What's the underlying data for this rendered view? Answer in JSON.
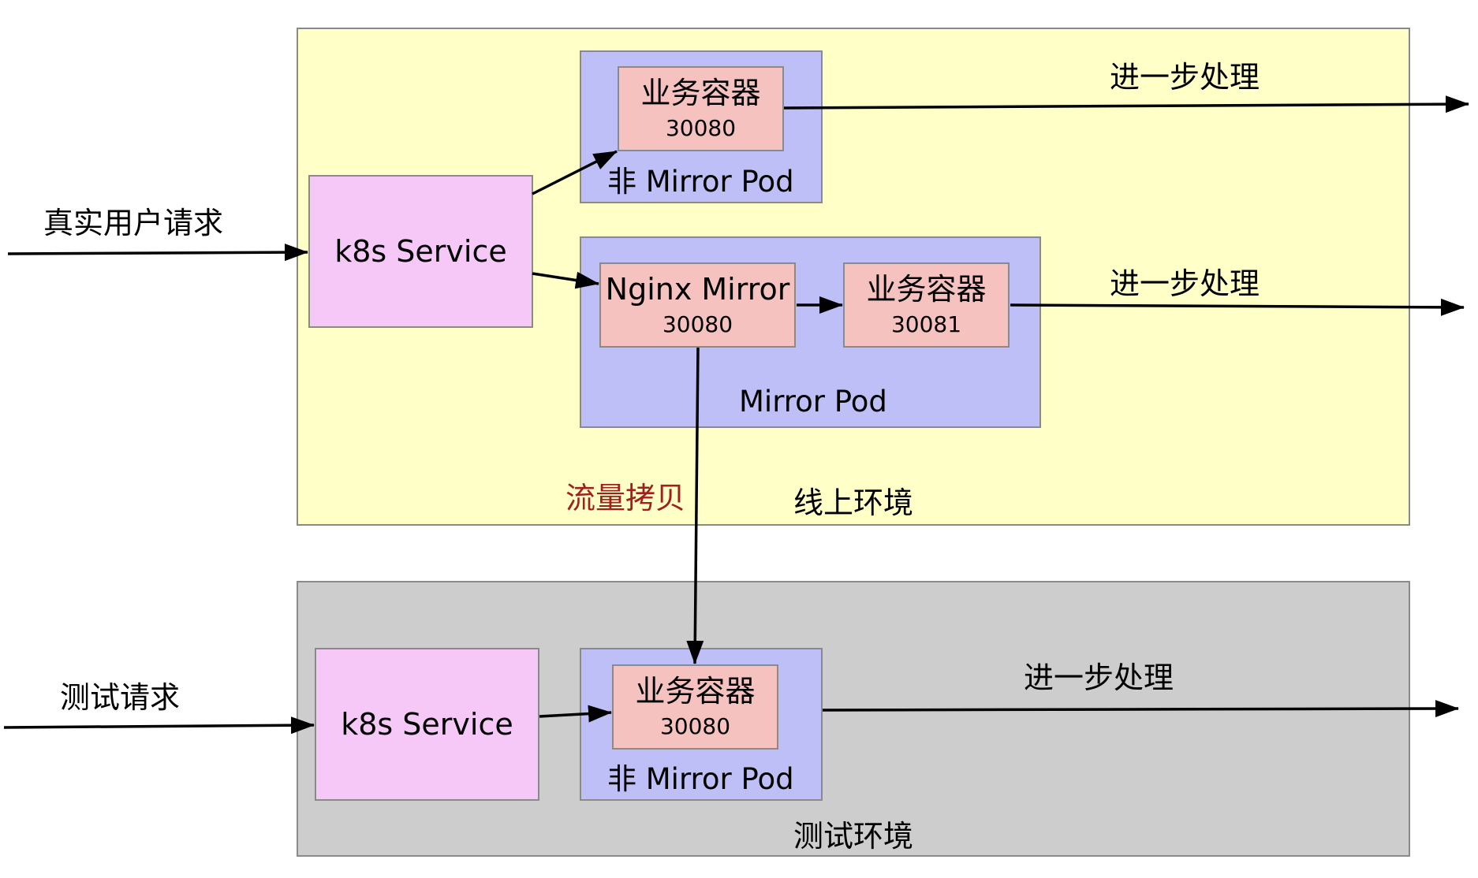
{
  "inputs": {
    "real_request": "真实用户请求",
    "test_request": "测试请求"
  },
  "production": {
    "env_label": "线上环境",
    "service_label": "k8s Service",
    "non_mirror_pod": {
      "label": "非 Mirror Pod",
      "container_name": "业务容器",
      "container_port": "30080"
    },
    "mirror_pod": {
      "label": "Mirror Pod",
      "nginx_name": "Nginx Mirror",
      "nginx_port": "30080",
      "container_name": "业务容器",
      "container_port": "30081"
    },
    "copy_label": "流量拷贝"
  },
  "test": {
    "env_label": "测试环境",
    "service_label": "k8s Service",
    "non_mirror_pod": {
      "label": "非 Mirror Pod",
      "container_name": "业务容器",
      "container_port": "30080"
    }
  },
  "outputs": {
    "further_1": "进一步处理",
    "further_2": "进一步处理",
    "further_3": "进一步处理"
  },
  "colors": {
    "prod_env": "#ffffc8",
    "test_env": "#cdcdcd",
    "service": "#f5c8f8",
    "pod": "#bfbff8",
    "container": "#f5c2bf",
    "copy_text": "#a02020"
  }
}
